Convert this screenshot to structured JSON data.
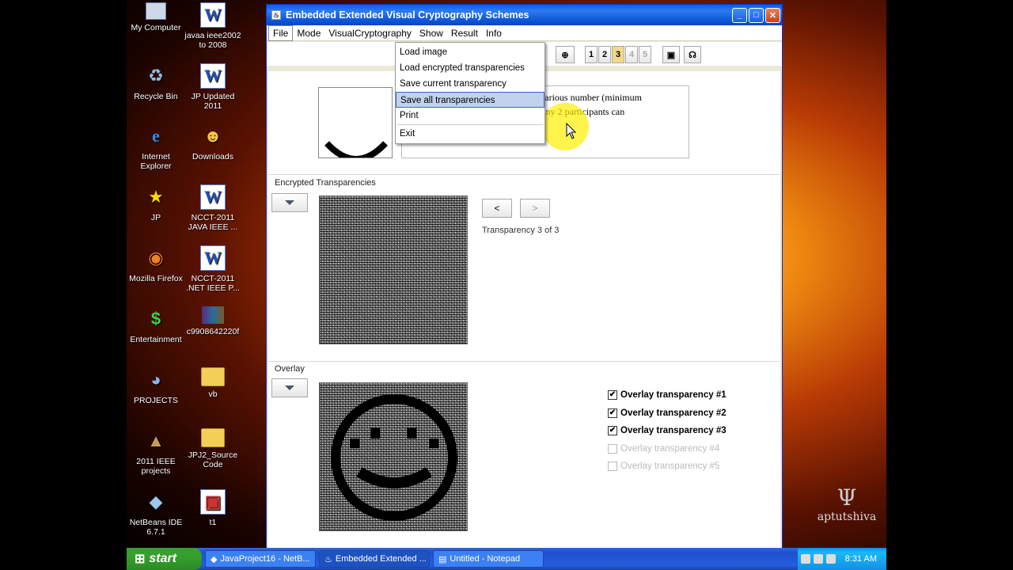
{
  "desktop_icons": [
    {
      "label": "My Computer",
      "icon": "computer-icon"
    },
    {
      "label": "javaa ieee2002\nto 2008",
      "icon": "word-doc-icon"
    },
    {
      "label": "Recycle Bin",
      "icon": "recycle-bin-icon"
    },
    {
      "label": "JP Updated\n2011",
      "icon": "word-doc-icon"
    },
    {
      "label": "Internet\nExplorer",
      "icon": "ie-icon"
    },
    {
      "label": "Downloads",
      "icon": "downloads-icon"
    },
    {
      "label": "JP",
      "icon": "star-shortcut-icon"
    },
    {
      "label": "NCCT-2011\nJAVA IEEE ...",
      "icon": "word-doc-icon"
    },
    {
      "label": "Mozilla Firefox",
      "icon": "firefox-icon"
    },
    {
      "label": "NCCT-2011\n.NET IEEE P...",
      "icon": "word-doc-icon"
    },
    {
      "label": "Entertainment",
      "icon": "dollar-shortcut-icon"
    },
    {
      "label": "c9908642220f",
      "icon": "archive-icon"
    },
    {
      "label": "PROJECTS",
      "icon": "projects-icon"
    },
    {
      "label": "vb",
      "icon": "folder-icon"
    },
    {
      "label": "2011 IEEE\nprojects",
      "icon": "pyramid-icon"
    },
    {
      "label": "JPJ2_Source\nCode",
      "icon": "folder-icon"
    },
    {
      "label": "NetBeans IDE\n6.7.1",
      "icon": "netbeans-icon"
    },
    {
      "label": "t1",
      "icon": "image-file-icon"
    }
  ],
  "window": {
    "title": "Embedded Extended Visual Cryptography Schemes",
    "menu": [
      "File",
      "Mode",
      "VisualCryptography",
      "Show",
      "Result",
      "Info"
    ],
    "toolbar_numbers": [
      "1",
      "2",
      "3",
      "4",
      "5"
    ],
    "file_menu": [
      "Load image",
      "Load encrypted transparencies",
      "Save current transparency",
      "Save all transparencies",
      "Print",
      "Exit"
    ],
    "description": "th this scheme you can generate a various number (minimum\nof transparencies, whereas always any 2 participants can\ncode.",
    "encrypted_label": "Encrypted Transparencies",
    "prev_label": "<",
    "next_label": ">",
    "transparency_status": "Transparency 3 of 3",
    "overlay_label": "Overlay",
    "overlay_checks": [
      {
        "label": "Overlay transparency #1",
        "checked": true,
        "enabled": true
      },
      {
        "label": "Overlay transparency #2",
        "checked": true,
        "enabled": true
      },
      {
        "label": "Overlay transparency #3",
        "checked": true,
        "enabled": true
      },
      {
        "label": "Overlay transparency #4",
        "checked": false,
        "enabled": false
      },
      {
        "label": "Overlay transparency #5",
        "checked": false,
        "enabled": false
      }
    ]
  },
  "taskbar": {
    "start": "start",
    "tasks": [
      "JavaProject16 - NetB...",
      "Embedded Extended ...",
      "Untitled - Notepad"
    ],
    "clock": "8:31 AM"
  },
  "watermark": "aptutshiva",
  "colors": {
    "title_blue": "#0a53d4",
    "taskbar_blue": "#245edb",
    "start_green": "#34a02c",
    "selected_tool": "#f4d78a"
  }
}
